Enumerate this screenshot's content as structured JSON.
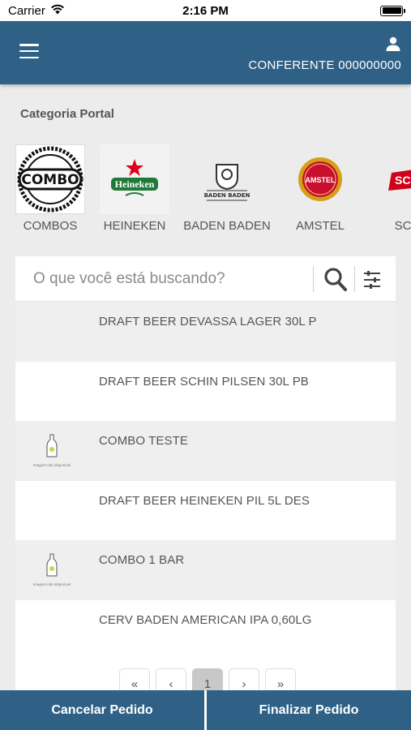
{
  "status_bar": {
    "carrier": "Carrier",
    "time": "2:16 PM"
  },
  "header": {
    "user_label": "CONFERENTE 000000000"
  },
  "categories": {
    "title": "Categoria Portal",
    "items": [
      {
        "name": "COMBOS",
        "logo_text": "COMBO"
      },
      {
        "name": "HEINEKEN",
        "logo_text": "Heineken"
      },
      {
        "name": "BADEN BADEN",
        "logo_text": "BADEN BADEN"
      },
      {
        "name": "AMSTEL",
        "logo_text": "AMSTEL"
      },
      {
        "name": "SCHIN",
        "logo_text": "SCHIN"
      }
    ]
  },
  "search": {
    "placeholder": "O que você está buscando?"
  },
  "products": [
    {
      "name": "DRAFT BEER DEVASSA LAGER 30L P",
      "has_image": false
    },
    {
      "name": "DRAFT BEER SCHIN PILSEN 30L PB",
      "has_image": false
    },
    {
      "name": "COMBO TESTE",
      "has_image": true,
      "image_caption": "Imagem não disponível"
    },
    {
      "name": "DRAFT BEER HEINEKEN PIL 5L DES",
      "has_image": false
    },
    {
      "name": "COMBO 1 BAR",
      "has_image": true,
      "image_caption": "Imagem não disponível"
    },
    {
      "name": "CERV BADEN AMERICAN IPA 0,60LG",
      "has_image": false
    }
  ],
  "pagination": {
    "first": "«",
    "prev": "‹",
    "current": "1",
    "next": "›",
    "last": "»"
  },
  "footer": {
    "cancel_label": "Cancelar Pedido",
    "finish_label": "Finalizar Pedido"
  },
  "colors": {
    "primary": "#2f6186",
    "alt_row": "#efefef",
    "heineken_green": "#1f7a3a",
    "heineken_red": "#e1001a",
    "amstel_gold": "#d4a017",
    "amstel_red": "#c8102e",
    "schin_red": "#d0021b"
  }
}
